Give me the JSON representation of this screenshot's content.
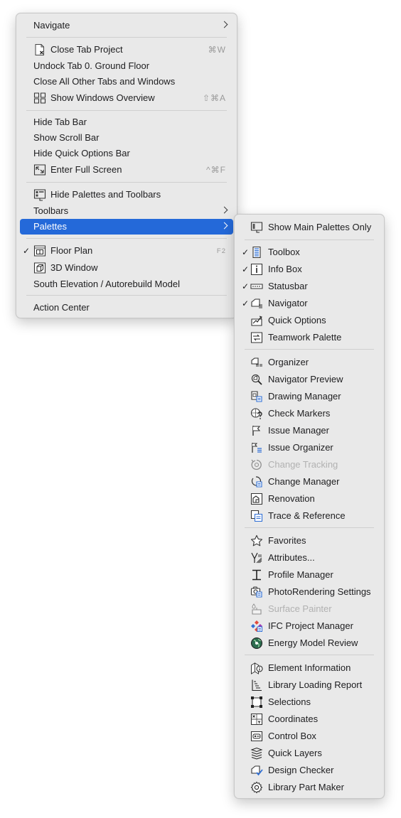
{
  "main_menu": {
    "navigate": "Navigate",
    "close_tab_project": "Close Tab Project",
    "close_tab_project_shortcut": "⌘W",
    "undock_tab": "Undock Tab 0. Ground Floor",
    "close_all_other": "Close All Other Tabs and Windows",
    "show_windows_overview": "Show Windows Overview",
    "show_windows_overview_shortcut": "⇧⌘A",
    "hide_tab_bar": "Hide Tab Bar",
    "show_scroll_bar": "Show Scroll Bar",
    "hide_quick_options_bar": "Hide Quick Options Bar",
    "enter_full_screen": "Enter Full Screen",
    "enter_full_screen_shortcut": "^⌘F",
    "hide_palettes_toolbars": "Hide Palettes and Toolbars",
    "toolbars": "Toolbars",
    "palettes": "Palettes",
    "floor_plan": "Floor Plan",
    "floor_plan_shortcut": "F2",
    "window_3d": "3D Window",
    "south_elevation": "South Elevation / Autorebuild Model",
    "action_center": "Action Center",
    "checkmark": "✓"
  },
  "palettes_menu": {
    "show_main_palettes_only": "Show Main Palettes Only",
    "toolbox": "Toolbox",
    "info_box": "Info Box",
    "statusbar": "Statusbar",
    "navigator": "Navigator",
    "quick_options": "Quick Options",
    "teamwork_palette": "Teamwork Palette",
    "organizer": "Organizer",
    "navigator_preview": "Navigator Preview",
    "drawing_manager": "Drawing Manager",
    "check_markers": "Check Markers",
    "issue_manager": "Issue Manager",
    "issue_organizer": "Issue Organizer",
    "change_tracking": "Change Tracking",
    "change_manager": "Change Manager",
    "renovation": "Renovation",
    "trace_reference": "Trace & Reference",
    "favorites": "Favorites",
    "attributes": "Attributes...",
    "profile_manager": "Profile Manager",
    "photorendering_settings": "PhotoRendering Settings",
    "surface_painter": "Surface Painter",
    "ifc_project_manager": "IFC Project Manager",
    "energy_model_review": "Energy Model Review",
    "element_information": "Element Information",
    "library_loading_report": "Library Loading Report",
    "selections": "Selections",
    "coordinates": "Coordinates",
    "control_box": "Control Box",
    "quick_layers": "Quick Layers",
    "design_checker": "Design Checker",
    "library_part_maker": "Library Part Maker"
  },
  "colors": {
    "menu_background": "#e9e9e9",
    "highlight": "#2469d9",
    "disabled_text": "#b1b1b1",
    "shortcut_text": "#9a9a9a",
    "accent_blue_icon": "#2f6fd6"
  }
}
